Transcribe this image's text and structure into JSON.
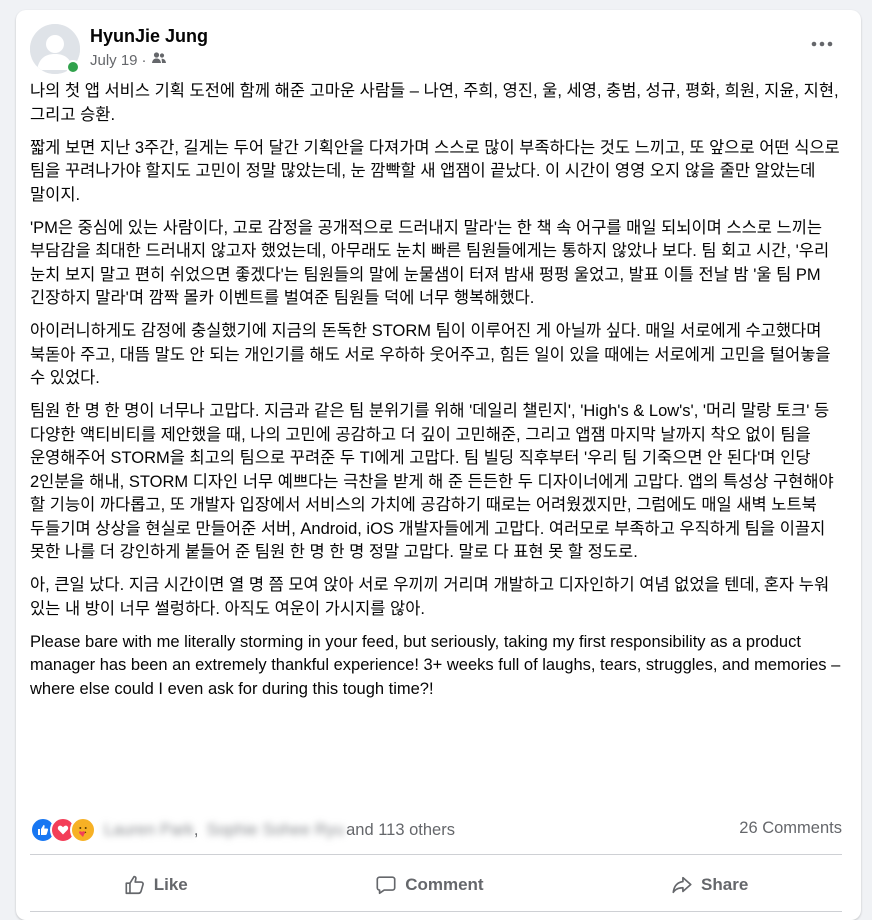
{
  "post": {
    "author": "HyunJie Jung",
    "date": "July 19",
    "separator": "·",
    "privacy_icon": "friends-icon",
    "paragraphs": [
      "나의 첫 앱 서비스 기획 도전에 함께 해준 고마운 사람들 – 나연, 주희, 영진, 울, 세영, 충범, 성규, 평화, 희원, 지윤, 지현, 그리고 승환.",
      "짧게 보면 지난 3주간, 길게는 두어 달간 기획안을 다져가며 스스로 많이 부족하다는 것도 느끼고, 또 앞으로 어떤 식으로 팀을 꾸려나가야 할지도 고민이 정말 많았는데, 눈 깜빡할 새 앱잼이 끝났다. 이 시간이 영영 오지 않을 줄만 알았는데 말이지.",
      "'PM은 중심에 있는 사람이다, 고로 감정을 공개적으로 드러내지 말라'는 한 책 속 어구를 매일 되뇌이며 스스로 느끼는 부담감을 최대한 드러내지 않고자 했었는데, 아무래도 눈치 빠른 팀원들에게는 통하지 않았나 보다. 팀 회고 시간, '우리 눈치 보지 말고 편히 쉬었으면 좋겠다'는 팀원들의 말에 눈물샘이 터져 밤새 펑펑 울었고, 발표 이틀 전날 밤 '울 팀 PM 긴장하지 말라'며 깜짝 몰카 이벤트를 벌여준 팀원들 덕에 너무 행복해했다.",
      "아이러니하게도 감정에 충실했기에 지금의 돈독한 STORM 팀이 이루어진 게 아닐까 싶다. 매일 서로에게 수고했다며 북돋아 주고, 대뜸 말도 안 되는 개인기를 해도 서로 우하하 웃어주고, 힘든 일이 있을 때에는 서로에게 고민을 털어놓을 수 있었다.",
      "팀원 한 명 한 명이 너무나 고맙다. 지금과 같은 팀 분위기를 위해 '데일리 챌린지', 'High's & Low's', '머리 말랑 토크' 등 다양한 액티비티를 제안했을 때, 나의 고민에 공감하고 더 깊이 고민해준, 그리고 앱잼 마지막 날까지 착오 없이 팀을 운영해주어 STORM을 최고의 팀으로 꾸려준 두 TI에게 고맙다. 팀 빌딩 직후부터 '우리 팀 기죽으면 안 된다'며 인당 2인분을 해내, STORM 디자인 너무 예쁘다는 극찬을 받게 해 준 든든한 두 디자이너에게 고맙다. 앱의 특성상 구현해야 할 기능이 까다롭고, 또 개발자 입장에서 서비스의 가치에 공감하기 때로는 어려웠겠지만, 그럼에도 매일 새벽 노트북 두들기며 상상을 현실로 만들어준 서버, Android, iOS 개발자들에게 고맙다. 여러모로 부족하고 우직하게 팀을 이끌지 못한 나를 더 강인하게 붙들어 준 팀원 한 명 한 명 정말 고맙다. 말로 다 표현 못 할 정도로.",
      "아, 큰일 났다. 지금 시간이면 열 명 쯤 모여 앉아 서로 우끼끼 거리며 개발하고 디자인하기 여념 없었을 텐데, 혼자 누워 있는 내 방이 너무 썰렁하다. 아직도 여운이 가시지를 않아.",
      "Please bare with me literally storming in your feed, but seriously, taking my first responsibility as a product manager has been an extremely thankful experience! 3+ weeks full of laughs, tears, struggles, and memories – where else could I even ask for during this tough time?!"
    ]
  },
  "reactions": {
    "icons": [
      "like-reaction-icon",
      "love-reaction-icon",
      "care-reaction-icon"
    ],
    "name1": "Lauren Park",
    "comma": ",",
    "name2": "Sophie Sohee Ryu",
    "others": "and 113 others",
    "comments": "26 Comments"
  },
  "actions": {
    "like": "Like",
    "comment": "Comment",
    "share": "Share"
  },
  "colors": {
    "like_blue": "#1877f2",
    "love_red": "#f33e58",
    "care_yellow": "#f7b125",
    "online_green": "#31a24c",
    "secondary_text": "#65676b"
  }
}
